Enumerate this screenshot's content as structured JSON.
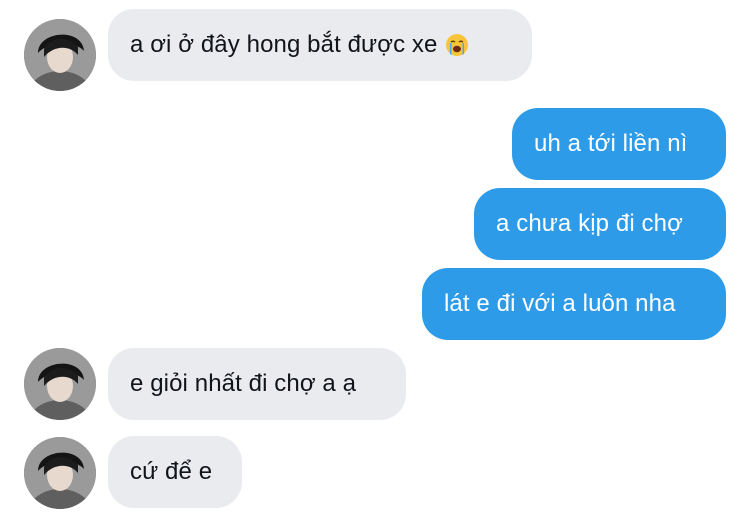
{
  "conversation": {
    "messages": [
      {
        "sender": "other",
        "text": "a ơi ở đây hong bắt được xe",
        "emoji": "loudly-crying-face"
      },
      {
        "sender": "me",
        "text": "uh a tới liền nì"
      },
      {
        "sender": "me",
        "text": "a chưa kịp đi chợ"
      },
      {
        "sender": "me",
        "text": "lát e đi với a luôn nha"
      },
      {
        "sender": "other",
        "text": "e giỏi nhất đi chợ a ạ"
      },
      {
        "sender": "other",
        "text": "cứ để e"
      }
    ]
  },
  "colors": {
    "incoming_bubble": "#e9ebef",
    "outgoing_bubble": "#2e9be9",
    "incoming_text": "#111418",
    "outgoing_text": "#ffffff"
  },
  "icons": {
    "avatar": "profile-photo",
    "emoji": "loudly-crying-face"
  }
}
